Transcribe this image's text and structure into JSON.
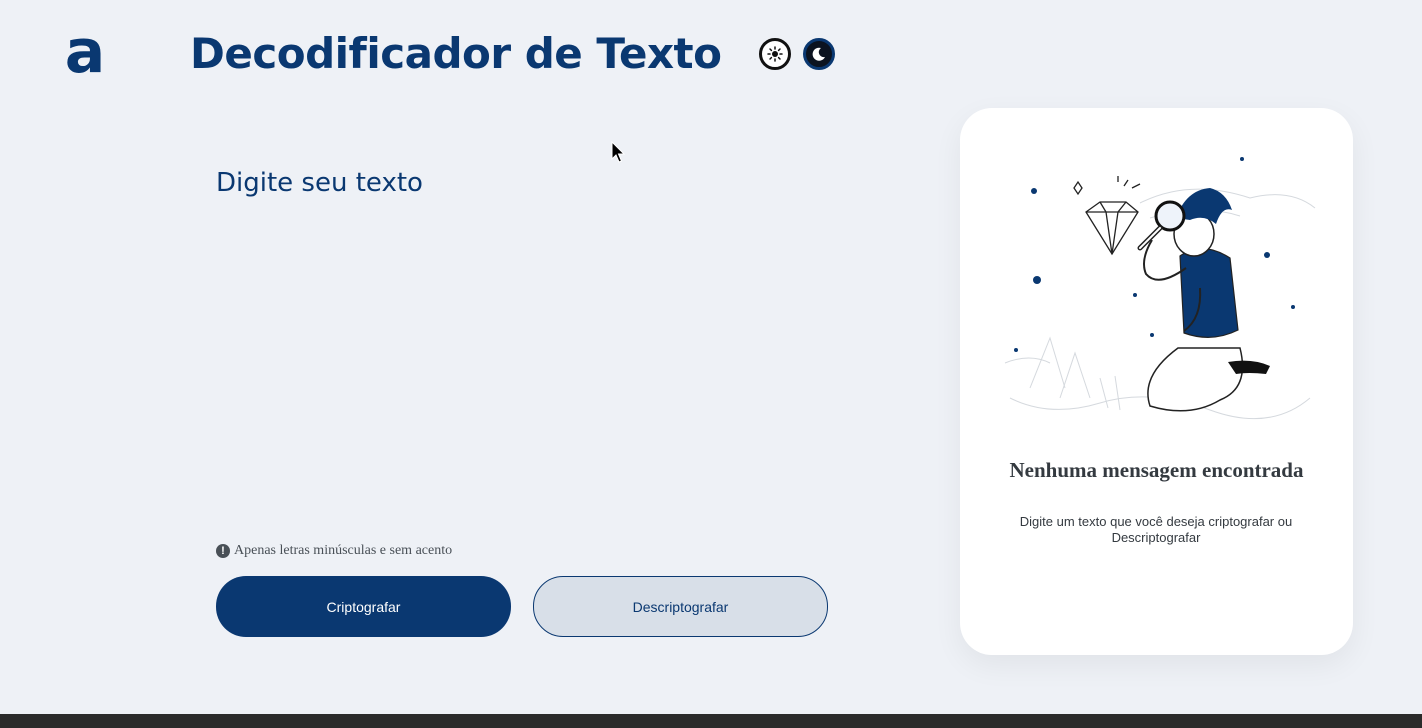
{
  "header": {
    "logo": "a",
    "title": "Decodificador de Texto",
    "theme_buttons": [
      "sun-icon",
      "moon-icon"
    ]
  },
  "editor": {
    "placeholder": "Digite seu texto",
    "hint_icon": "!",
    "hint": "Apenas letras minúsculas e sem acento"
  },
  "actions": {
    "encrypt_label": "Criptografar",
    "decrypt_label": "Descriptografar"
  },
  "output": {
    "title": "Nenhuma mensagem encontrada",
    "text": "Digite um texto que você deseja criptografar ou Descriptografar",
    "illustration": "person-with-magnifier-illustration"
  },
  "colors": {
    "primary": "#0a3871",
    "background": "#eef1f6",
    "card": "#ffffff",
    "secondary_button": "#d8dfe8"
  }
}
